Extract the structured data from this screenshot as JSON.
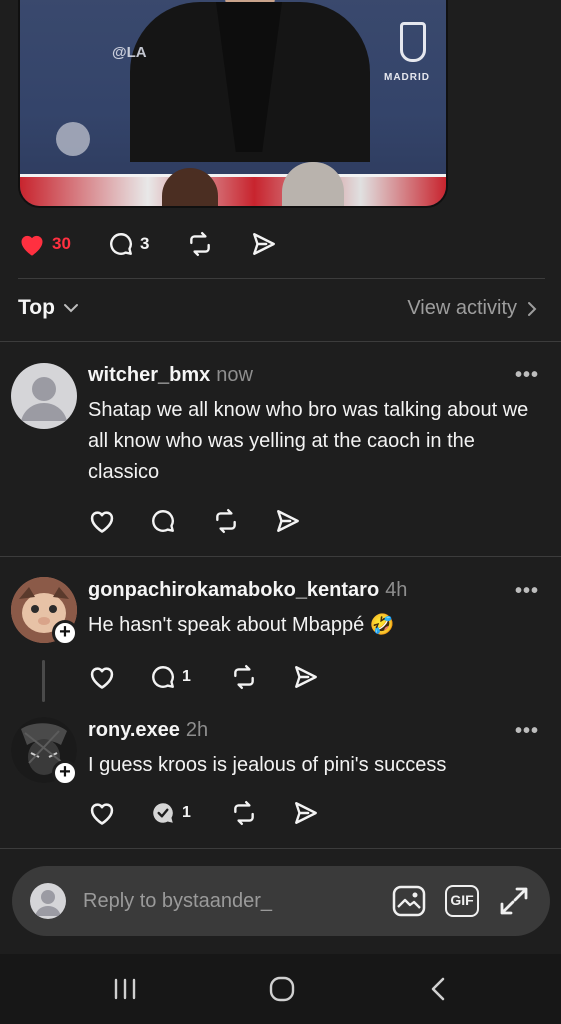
{
  "post": {
    "likes": "30",
    "comments": "3"
  },
  "sort": {
    "label": "Top",
    "view_activity": "View activity"
  },
  "comments": [
    {
      "username": "witcher_bmx",
      "time": "now",
      "text": "Shatap we all know who bro was talking about we all know who was yelling at the caoch in the classico",
      "reply_count": ""
    },
    {
      "username": "gonpachirokamaboko_kentaro",
      "time": "4h",
      "text": "He hasn't speak about Mbappé 🤣",
      "reply_count": "1"
    },
    {
      "username": "rony.exee",
      "time": "2h",
      "text": "I guess kroos is jealous of pini's success",
      "reply_count": "1"
    }
  ],
  "reply": {
    "placeholder": "Reply to bystaander_",
    "gif_label": "GIF"
  },
  "colors": {
    "background": "#1e1e1e",
    "like_red": "#ff3040",
    "muted": "#9d9d9d"
  },
  "icons": [
    "heart-icon",
    "comment-icon",
    "repost-icon",
    "share-icon",
    "chevron-down-icon",
    "chevron-right-icon",
    "more-icon",
    "image-icon",
    "expand-icon"
  ]
}
